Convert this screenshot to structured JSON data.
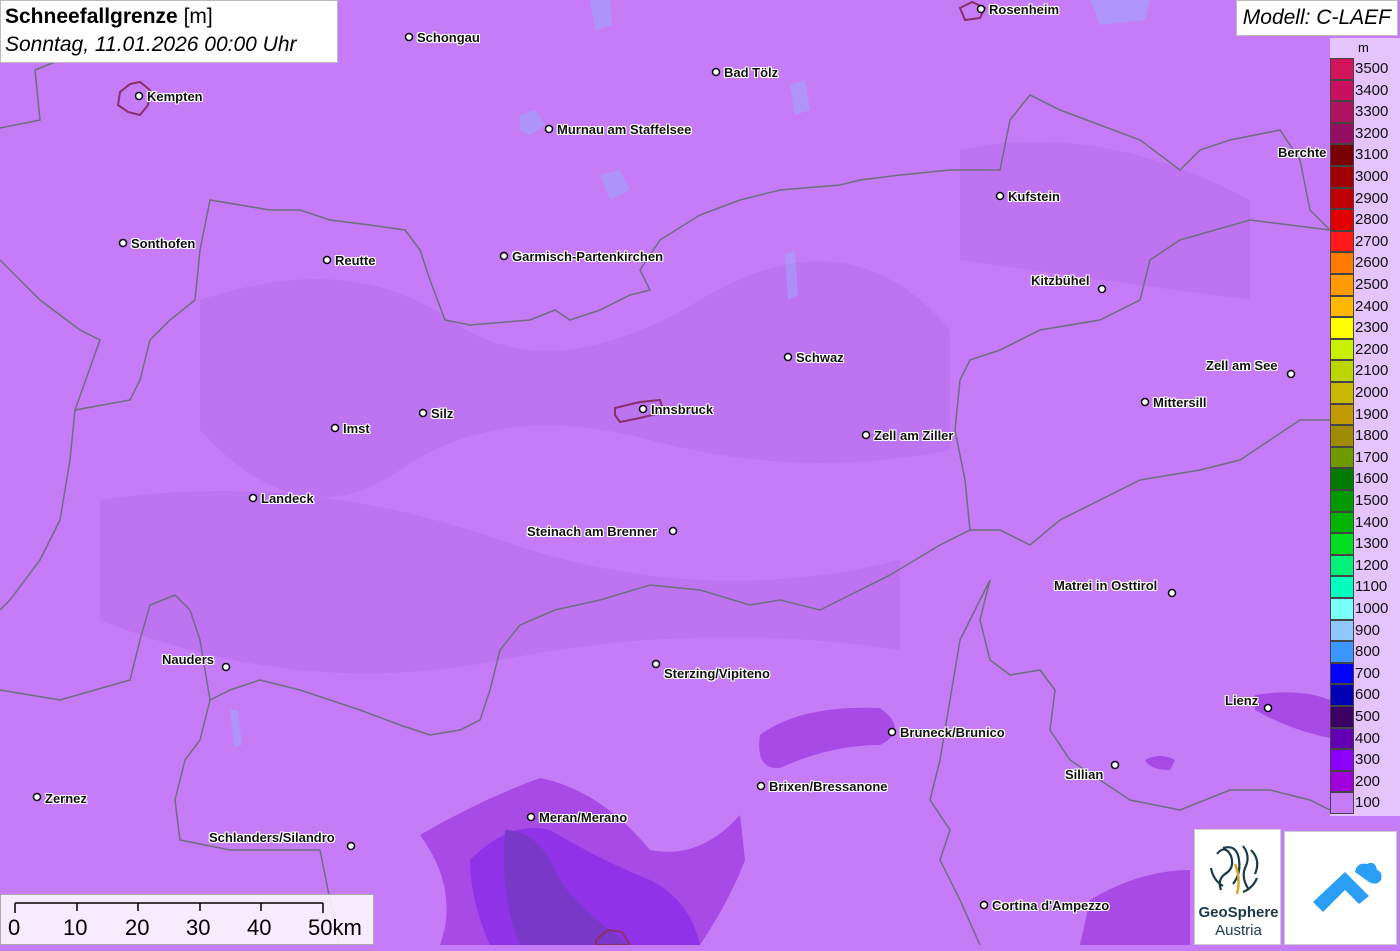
{
  "title": {
    "main": "Schneefallgrenze",
    "unit": "[m]",
    "subtitle": "Sonntag, 11.01.2026 00:00 Uhr"
  },
  "model": "Modell: C-LAEF",
  "legend": {
    "unit": "m",
    "entries": [
      {
        "label": "3500",
        "color": "#d2145a"
      },
      {
        "label": "3400",
        "color": "#c8105f"
      },
      {
        "label": "3300",
        "color": "#b01262"
      },
      {
        "label": "3200",
        "color": "#960e64"
      },
      {
        "label": "3100",
        "color": "#7a0000"
      },
      {
        "label": "3000",
        "color": "#a00000"
      },
      {
        "label": "2900",
        "color": "#c00000"
      },
      {
        "label": "2800",
        "color": "#e00000"
      },
      {
        "label": "2700",
        "color": "#ff1a1a"
      },
      {
        "label": "2600",
        "color": "#ff7a00"
      },
      {
        "label": "2500",
        "color": "#ff9a00"
      },
      {
        "label": "2400",
        "color": "#ffb800"
      },
      {
        "label": "2300",
        "color": "#ffff00"
      },
      {
        "label": "2200",
        "color": "#c8f000"
      },
      {
        "label": "2100",
        "color": "#bcd400"
      },
      {
        "label": "2000",
        "color": "#c8b800"
      },
      {
        "label": "1900",
        "color": "#c09a00"
      },
      {
        "label": "1800",
        "color": "#a08a00"
      },
      {
        "label": "1700",
        "color": "#6e9a00"
      },
      {
        "label": "1600",
        "color": "#007a00"
      },
      {
        "label": "1500",
        "color": "#009a00"
      },
      {
        "label": "1400",
        "color": "#00b400"
      },
      {
        "label": "1300",
        "color": "#00dc1e"
      },
      {
        "label": "1200",
        "color": "#00f07a"
      },
      {
        "label": "1100",
        "color": "#00ffbe"
      },
      {
        "label": "1000",
        "color": "#7affff"
      },
      {
        "label": "900",
        "color": "#8cc8ff"
      },
      {
        "label": "800",
        "color": "#3c96ff"
      },
      {
        "label": "700",
        "color": "#0000ff"
      },
      {
        "label": "600",
        "color": "#0000b4"
      },
      {
        "label": "500",
        "color": "#3c0064"
      },
      {
        "label": "400",
        "color": "#6400b4"
      },
      {
        "label": "300",
        "color": "#8c00ff"
      },
      {
        "label": "200",
        "color": "#a000dc"
      },
      {
        "label": "100",
        "color": "#c67cf6"
      }
    ]
  },
  "cities": [
    {
      "name": "Schongau"
    },
    {
      "name": "Rosenheim"
    },
    {
      "name": "Kempten"
    },
    {
      "name": "Bad Tölz"
    },
    {
      "name": "Murnau am Staffelsee"
    },
    {
      "name": "Berchte"
    },
    {
      "name": "Kufstein"
    },
    {
      "name": "Sonthofen"
    },
    {
      "name": "Reutte"
    },
    {
      "name": "Garmisch-Partenkirchen"
    },
    {
      "name": "Kitzbühel"
    },
    {
      "name": "Schwaz"
    },
    {
      "name": "Zell am See"
    },
    {
      "name": "Mittersill"
    },
    {
      "name": "Silz"
    },
    {
      "name": "Innsbruck"
    },
    {
      "name": "Imst"
    },
    {
      "name": "Zell am Ziller"
    },
    {
      "name": "Landeck"
    },
    {
      "name": "Steinach am Brenner"
    },
    {
      "name": "Matrei in Osttirol"
    },
    {
      "name": "Nauders"
    },
    {
      "name": "Sterzing/Vipiteno"
    },
    {
      "name": "Lienz"
    },
    {
      "name": "Bruneck/Brunico"
    },
    {
      "name": "Sillian"
    },
    {
      "name": "Brixen/Bressanone"
    },
    {
      "name": "Zernez"
    },
    {
      "name": "Meran/Merano"
    },
    {
      "name": "Schlanders/Silandro"
    },
    {
      "name": "Cortina d'Ampezzo"
    }
  ],
  "scalebar": {
    "labels": [
      "0",
      "10",
      "20",
      "30",
      "40",
      "50km"
    ]
  },
  "logos": {
    "geosphere_line1": "GeoSphere",
    "geosphere_line2": "Austria"
  }
}
